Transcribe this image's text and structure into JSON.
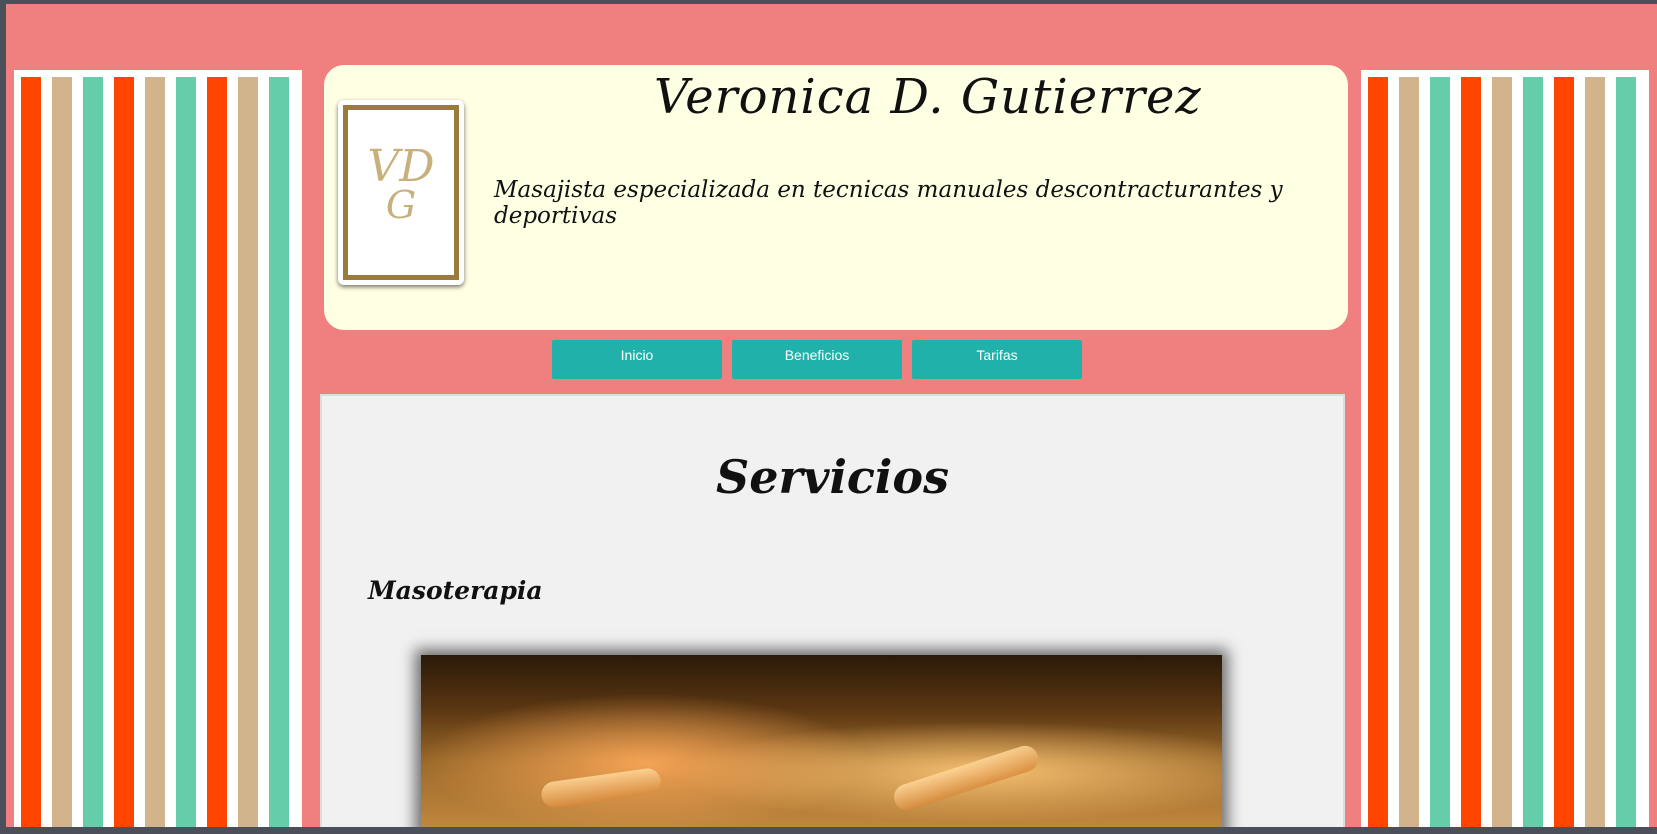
{
  "header": {
    "title": "Veronica D. Gutierrez",
    "subtitle": "Masajista especializada en tecnicas manuales descontracturantes y deportivas",
    "logo_monogram_top": "VD",
    "logo_monogram_bottom": "G"
  },
  "nav": {
    "items": [
      {
        "label": "Inicio"
      },
      {
        "label": "Beneficios"
      },
      {
        "label": "Tarifas"
      }
    ]
  },
  "main": {
    "title": "Servicios",
    "section_heading": "Masoterapia"
  },
  "colors": {
    "page_background": "#f08080",
    "header_background": "#ffffe4",
    "nav_button": "#20b2aa",
    "stripe_orange": "#ff4500",
    "stripe_tan": "#d2b48c",
    "stripe_teal": "#66cdaa",
    "content_background": "#f1f1f1"
  }
}
